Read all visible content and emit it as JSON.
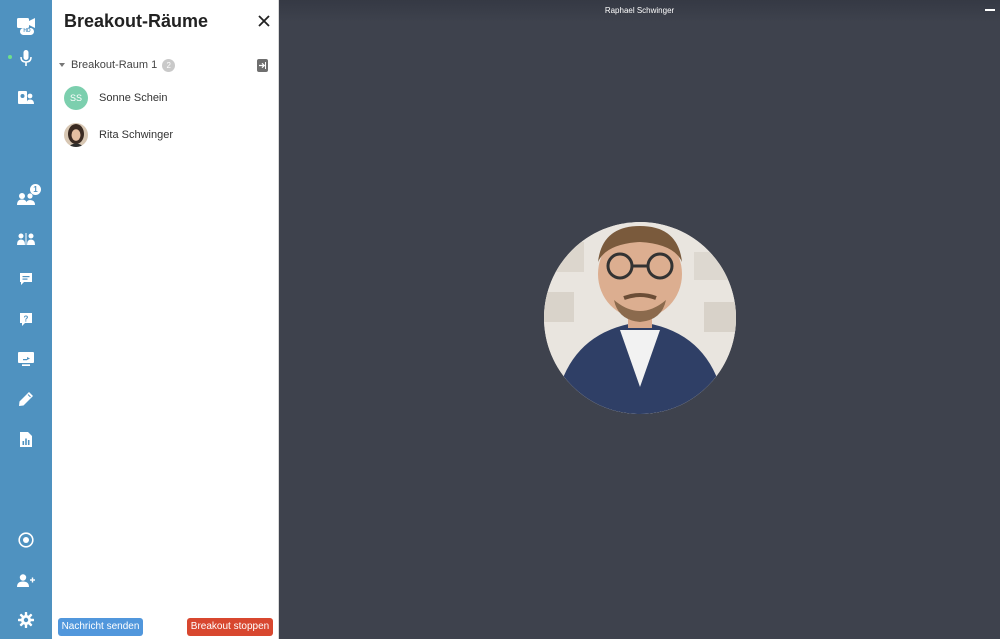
{
  "rail": {
    "camera_badge": "HD",
    "participants_badge": "1",
    "accent": "#4f92c0"
  },
  "panel": {
    "title": "Breakout-Räume",
    "rooms": [
      {
        "name": "Breakout-Raum 1",
        "count": "2",
        "members": [
          {
            "name": "Sonne Schein",
            "initials": "SS"
          },
          {
            "name": "Rita Schwinger",
            "initials": ""
          }
        ]
      }
    ],
    "send_message_label": "Nachricht senden",
    "stop_breakout_label": "Breakout stoppen"
  },
  "stage": {
    "speaker_name": "Raphael Schwinger"
  },
  "colors": {
    "stage_bg": "#3e424d",
    "send_button": "#5197dc",
    "stop_button": "#d8472f",
    "initials_avatar": "#7ccfae"
  }
}
